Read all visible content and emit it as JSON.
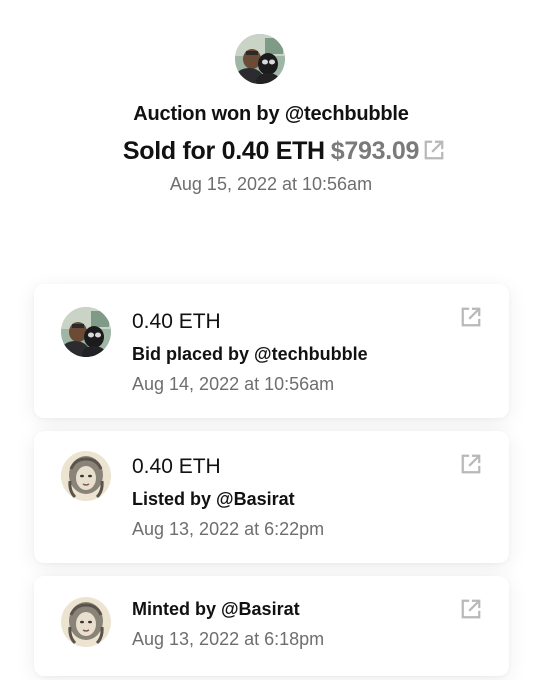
{
  "summary": {
    "won_text": "Auction won by @techbubble",
    "sold_prefix": "Sold for 0.40 ETH",
    "sold_usd": "$793.09",
    "date": "Aug 15, 2022 at 10:56am"
  },
  "history": [
    {
      "amount": "0.40 ETH",
      "action": "Bid placed by @techbubble",
      "date": "Aug 14, 2022 at 10:56am",
      "avatar": "techbubble-avatar"
    },
    {
      "amount": "0.40 ETH",
      "action": "Listed by @Basirat",
      "date": "Aug 13, 2022 at 6:22pm",
      "avatar": "basirat-avatar"
    },
    {
      "action": "Minted by @Basirat",
      "date": "Aug 13, 2022 at 6:18pm",
      "avatar": "basirat-avatar"
    }
  ],
  "icons": {
    "external": "external-link-icon"
  },
  "colors": {
    "text": "#111111",
    "muted": "#6e6e6e",
    "icon": "#b8b8b8"
  }
}
